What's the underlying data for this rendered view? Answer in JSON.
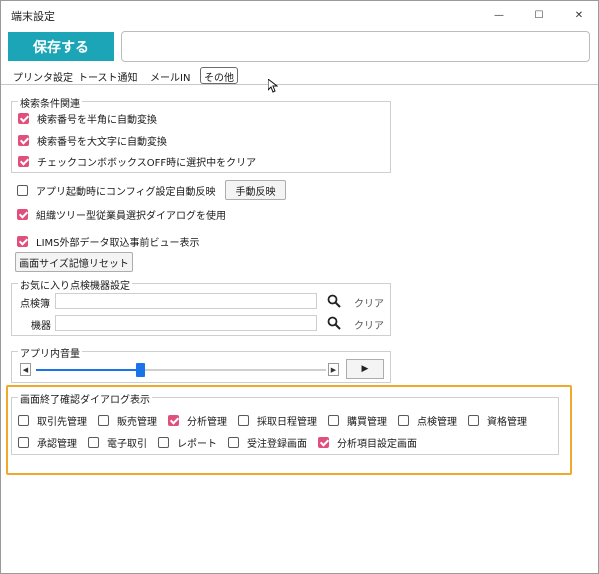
{
  "window": {
    "title": "端末設定",
    "controls": {
      "minimize": "—",
      "maximize": "☐",
      "close": "✕"
    }
  },
  "toolbar": {
    "save_label": "保存する",
    "message": ""
  },
  "tabs": [
    {
      "label": "プリンタ設定",
      "active": false
    },
    {
      "label": "トースト通知",
      "active": false
    },
    {
      "label": "メールIN",
      "active": false
    },
    {
      "label": "その他",
      "active": true
    }
  ],
  "search_group": {
    "title": "検索条件関連",
    "options": [
      {
        "label": "検索番号を半角に自動変換",
        "checked": true
      },
      {
        "label": "検索番号を大文字に自動変換",
        "checked": true
      },
      {
        "label": "チェックコンボボックスOFF時に選択中をクリア",
        "checked": true
      }
    ]
  },
  "config_reflect": {
    "label": "アプリ起動時にコンフィグ設定自動反映",
    "checked": false,
    "button": "手動反映"
  },
  "org_tree": {
    "label": "組織ツリー型従業員選択ダイアログを使用",
    "checked": true
  },
  "lims_preview": {
    "label": "LIMS外部データ取込事前ビュー表示",
    "checked": true
  },
  "screen_size_reset": "画面サイズ記憶リセット",
  "favorites": {
    "title": "お気に入り点検機器設定",
    "rows": [
      {
        "label": "点検簿",
        "value": "",
        "clear": "クリア"
      },
      {
        "label": "機器",
        "value": "",
        "clear": "クリア"
      }
    ]
  },
  "volume": {
    "title": "アプリ内音量",
    "level": 0.36,
    "left_arrow": "◀",
    "right_arrow": "▶",
    "play": "▶"
  },
  "exit_dialog": {
    "title": "画面終了確認ダイアログ表示",
    "row1": [
      {
        "label": "取引先管理",
        "checked": false
      },
      {
        "label": "販売管理",
        "checked": false
      },
      {
        "label": "分析管理",
        "checked": true
      },
      {
        "label": "採取日程管理",
        "checked": false
      },
      {
        "label": "購買管理",
        "checked": false
      },
      {
        "label": "点検管理",
        "checked": false
      },
      {
        "label": "資格管理",
        "checked": false
      }
    ],
    "row2": [
      {
        "label": "承認管理",
        "checked": false
      },
      {
        "label": "電子取引",
        "checked": false
      },
      {
        "label": "レポート",
        "checked": false
      },
      {
        "label": "受注登録画面",
        "checked": false
      },
      {
        "label": "分析項目設定画面",
        "checked": true
      }
    ]
  },
  "colors": {
    "accent": "#1ba5b6",
    "checkbox_on": "#e0507c",
    "highlight": "#f0a92a",
    "slider": "#1a73e8"
  }
}
